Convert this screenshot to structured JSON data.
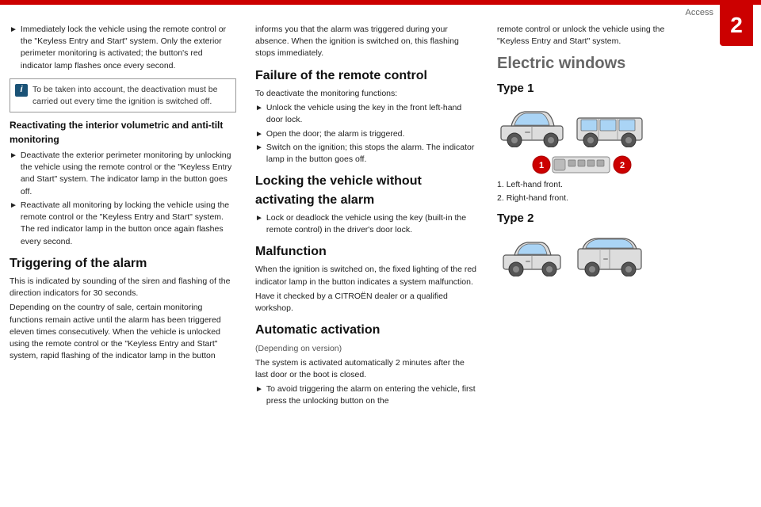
{
  "page": {
    "header": "Access",
    "number": "2"
  },
  "col_left": {
    "para1": "Immediately lock the vehicle using the remote control or the \"Keyless Entry and Start\" system. Only the exterior perimeter monitoring is activated; the button's red indicator lamp flashes once every second.",
    "info_box": "To be taken into account, the deactivation must be carried out every time the ignition is switched off.",
    "section1_title": "Reactivating the interior volumetric and anti-tilt monitoring",
    "para2": "Deactivate the exterior perimeter monitoring by unlocking the vehicle using the remote control or the \"Keyless Entry and Start\" system. The indicator lamp in the button goes off.",
    "para3": "Reactivate all monitoring by locking the vehicle using the remote control or the \"Keyless Entry and Start\" system. The red indicator lamp in the button once again flashes every second.",
    "section2_title": "Triggering of the alarm",
    "para4": "This is indicated by sounding of the siren and flashing of the direction indicators for 30 seconds.",
    "para5": "Depending on the country of sale, certain monitoring functions remain active until the alarm has been triggered eleven times consecutively. When the vehicle is unlocked using the remote control or the \"Keyless Entry and Start\" system, rapid flashing of the indicator lamp in the button"
  },
  "col_mid": {
    "para_cont": "informs you that the alarm was triggered during your absence. When the ignition is switched on, this flashing stops immediately.",
    "section3_title": "Failure of the remote control",
    "para6": "To deactivate the monitoring functions:",
    "arrow1": "Unlock the vehicle using the key in the front left-hand door lock.",
    "arrow2": "Open the door; the alarm is triggered.",
    "arrow3": "Switch on the ignition; this stops the alarm. The indicator lamp in the button goes off.",
    "section4_title": "Locking the vehicle without activating the alarm",
    "arrow4": "Lock or deadlock the vehicle using the key (built-in the remote control) in the driver's door lock.",
    "section5_title": "Malfunction",
    "para7": "When the ignition is switched on, the fixed lighting of the red indicator lamp in the button indicates a system malfunction.",
    "para8": "Have it checked by a CITROËN dealer or a qualified workshop.",
    "section6_title": "Automatic activation",
    "para9": "(Depending on version)",
    "para10": "The system is activated automatically 2 minutes after the last door or the boot is closed.",
    "arrow5": "To avoid triggering the alarm on entering the vehicle, first press the unlocking button on the"
  },
  "col_right": {
    "para_cont": "remote control or unlock the vehicle using the \"Keyless Entry and Start\" system.",
    "section_title": "Electric windows",
    "type1_title": "Type 1",
    "numbered_list": [
      "Left-hand front.",
      "Right-hand front."
    ],
    "type2_title": "Type 2"
  },
  "icons": {
    "arrow": "►",
    "info": "i"
  }
}
